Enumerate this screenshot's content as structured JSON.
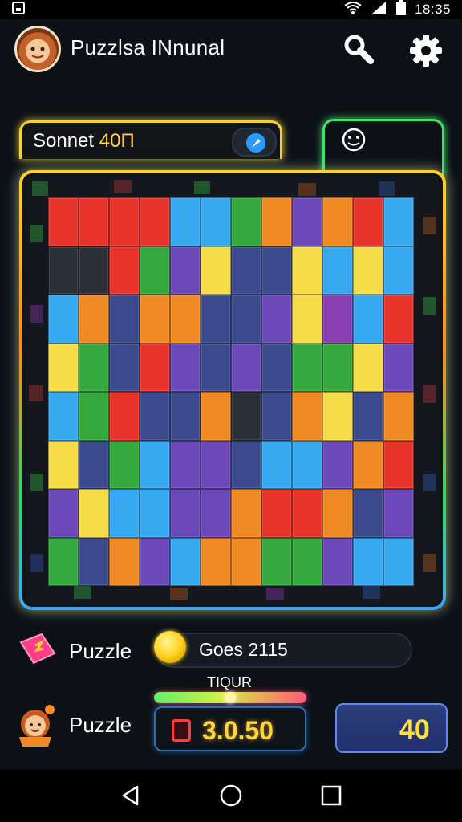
{
  "status_bar": {
    "time": "18:35",
    "icons": [
      "notification-icon",
      "wifi-icon",
      "signal-icon",
      "battery-icon"
    ]
  },
  "header": {
    "title": "Puzzlsa INnunal",
    "icons": [
      "avatar",
      "search-icon",
      "gear-icon"
    ]
  },
  "score_tab": {
    "label": "Sonnet",
    "value": "40П",
    "action_icon": "pointer-icon"
  },
  "side_tab": {
    "icon": "emoji-icon"
  },
  "board": {
    "rows": 8,
    "cols": 12,
    "palette": {
      "R": "#e8332b",
      "B": "#35a8f0",
      "G": "#34a83c",
      "O": "#f08a24",
      "P": "#6a48b8",
      "Y": "#f6dc48",
      "N": "#3a4a8c",
      "D": "#2b2f37",
      "T": "#4ab0e8",
      "L": "#8a3fb0"
    },
    "tiles": [
      [
        "R",
        "R",
        "R",
        "R",
        "B",
        "B",
        "G",
        "O",
        "P",
        "O",
        "R",
        "B"
      ],
      [
        "D",
        "D",
        "R",
        "G",
        "P",
        "Y",
        "N",
        "N",
        "Y",
        "B",
        "Y",
        "B"
      ],
      [
        "B",
        "O",
        "N",
        "O",
        "O",
        "N",
        "N",
        "P",
        "Y",
        "L",
        "B",
        "R"
      ],
      [
        "Y",
        "G",
        "N",
        "R",
        "P",
        "N",
        "P",
        "N",
        "G",
        "G",
        "Y",
        "P"
      ],
      [
        "B",
        "G",
        "R",
        "N",
        "N",
        "O",
        "D",
        "N",
        "O",
        "Y",
        "N",
        "O"
      ],
      [
        "Y",
        "N",
        "G",
        "B",
        "P",
        "P",
        "N",
        "B",
        "B",
        "P",
        "O",
        "R"
      ],
      [
        "P",
        "Y",
        "B",
        "B",
        "P",
        "P",
        "O",
        "R",
        "R",
        "O",
        "N",
        "P"
      ],
      [
        "G",
        "N",
        "O",
        "P",
        "B",
        "O",
        "O",
        "G",
        "G",
        "P",
        "B",
        "B"
      ]
    ]
  },
  "footer": {
    "puzzle_label_1": "Puzzle",
    "coins_text": "Goes 2115",
    "puzzle_label_2": "Puzzle",
    "timer_label": "TIQUR",
    "timer_progress": 0.5,
    "timer_value": "3.0.50",
    "count_value": "40"
  },
  "nav": {
    "back": "back-icon",
    "home": "home-icon",
    "recents": "recents-icon"
  }
}
